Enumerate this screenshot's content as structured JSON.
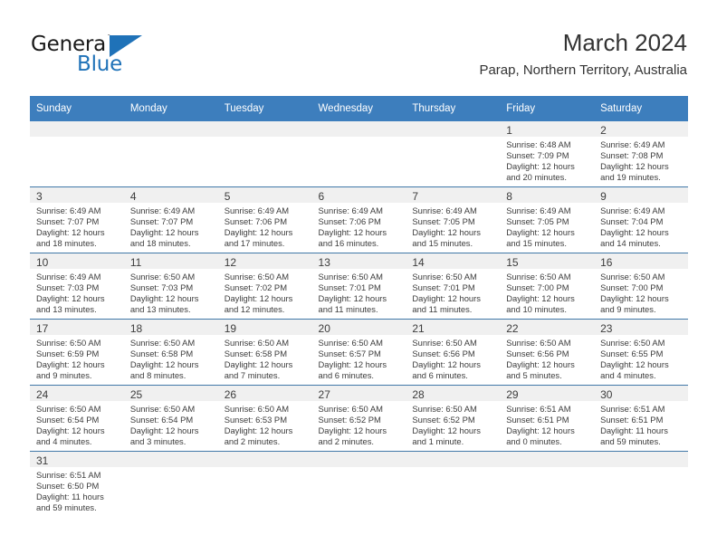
{
  "brand": {
    "name_top": "General",
    "name_bottom": "Blue",
    "accent_color": "#1f72b8"
  },
  "header": {
    "month_title": "March 2024",
    "location": "Parap, Northern Territory, Australia"
  },
  "theme": {
    "header_row_bg": "#3d7ebd",
    "cell_shade_bg": "#f0f0f0",
    "grid_line": "#4178a8",
    "text": "#3c3c3c"
  },
  "calendar": {
    "weekday_headers": [
      "Sunday",
      "Monday",
      "Tuesday",
      "Wednesday",
      "Thursday",
      "Friday",
      "Saturday"
    ],
    "weeks": [
      [
        {
          "empty": true
        },
        {
          "empty": true
        },
        {
          "empty": true
        },
        {
          "empty": true
        },
        {
          "empty": true
        },
        {
          "day": "1",
          "sunrise": "Sunrise: 6:48 AM",
          "sunset": "Sunset: 7:09 PM",
          "daylight1": "Daylight: 12 hours",
          "daylight2": "and 20 minutes."
        },
        {
          "day": "2",
          "sunrise": "Sunrise: 6:49 AM",
          "sunset": "Sunset: 7:08 PM",
          "daylight1": "Daylight: 12 hours",
          "daylight2": "and 19 minutes."
        }
      ],
      [
        {
          "day": "3",
          "sunrise": "Sunrise: 6:49 AM",
          "sunset": "Sunset: 7:07 PM",
          "daylight1": "Daylight: 12 hours",
          "daylight2": "and 18 minutes."
        },
        {
          "day": "4",
          "sunrise": "Sunrise: 6:49 AM",
          "sunset": "Sunset: 7:07 PM",
          "daylight1": "Daylight: 12 hours",
          "daylight2": "and 18 minutes."
        },
        {
          "day": "5",
          "sunrise": "Sunrise: 6:49 AM",
          "sunset": "Sunset: 7:06 PM",
          "daylight1": "Daylight: 12 hours",
          "daylight2": "and 17 minutes."
        },
        {
          "day": "6",
          "sunrise": "Sunrise: 6:49 AM",
          "sunset": "Sunset: 7:06 PM",
          "daylight1": "Daylight: 12 hours",
          "daylight2": "and 16 minutes."
        },
        {
          "day": "7",
          "sunrise": "Sunrise: 6:49 AM",
          "sunset": "Sunset: 7:05 PM",
          "daylight1": "Daylight: 12 hours",
          "daylight2": "and 15 minutes."
        },
        {
          "day": "8",
          "sunrise": "Sunrise: 6:49 AM",
          "sunset": "Sunset: 7:05 PM",
          "daylight1": "Daylight: 12 hours",
          "daylight2": "and 15 minutes."
        },
        {
          "day": "9",
          "sunrise": "Sunrise: 6:49 AM",
          "sunset": "Sunset: 7:04 PM",
          "daylight1": "Daylight: 12 hours",
          "daylight2": "and 14 minutes."
        }
      ],
      [
        {
          "day": "10",
          "sunrise": "Sunrise: 6:49 AM",
          "sunset": "Sunset: 7:03 PM",
          "daylight1": "Daylight: 12 hours",
          "daylight2": "and 13 minutes."
        },
        {
          "day": "11",
          "sunrise": "Sunrise: 6:50 AM",
          "sunset": "Sunset: 7:03 PM",
          "daylight1": "Daylight: 12 hours",
          "daylight2": "and 13 minutes."
        },
        {
          "day": "12",
          "sunrise": "Sunrise: 6:50 AM",
          "sunset": "Sunset: 7:02 PM",
          "daylight1": "Daylight: 12 hours",
          "daylight2": "and 12 minutes."
        },
        {
          "day": "13",
          "sunrise": "Sunrise: 6:50 AM",
          "sunset": "Sunset: 7:01 PM",
          "daylight1": "Daylight: 12 hours",
          "daylight2": "and 11 minutes."
        },
        {
          "day": "14",
          "sunrise": "Sunrise: 6:50 AM",
          "sunset": "Sunset: 7:01 PM",
          "daylight1": "Daylight: 12 hours",
          "daylight2": "and 11 minutes."
        },
        {
          "day": "15",
          "sunrise": "Sunrise: 6:50 AM",
          "sunset": "Sunset: 7:00 PM",
          "daylight1": "Daylight: 12 hours",
          "daylight2": "and 10 minutes."
        },
        {
          "day": "16",
          "sunrise": "Sunrise: 6:50 AM",
          "sunset": "Sunset: 7:00 PM",
          "daylight1": "Daylight: 12 hours",
          "daylight2": "and 9 minutes."
        }
      ],
      [
        {
          "day": "17",
          "sunrise": "Sunrise: 6:50 AM",
          "sunset": "Sunset: 6:59 PM",
          "daylight1": "Daylight: 12 hours",
          "daylight2": "and 9 minutes."
        },
        {
          "day": "18",
          "sunrise": "Sunrise: 6:50 AM",
          "sunset": "Sunset: 6:58 PM",
          "daylight1": "Daylight: 12 hours",
          "daylight2": "and 8 minutes."
        },
        {
          "day": "19",
          "sunrise": "Sunrise: 6:50 AM",
          "sunset": "Sunset: 6:58 PM",
          "daylight1": "Daylight: 12 hours",
          "daylight2": "and 7 minutes."
        },
        {
          "day": "20",
          "sunrise": "Sunrise: 6:50 AM",
          "sunset": "Sunset: 6:57 PM",
          "daylight1": "Daylight: 12 hours",
          "daylight2": "and 6 minutes."
        },
        {
          "day": "21",
          "sunrise": "Sunrise: 6:50 AM",
          "sunset": "Sunset: 6:56 PM",
          "daylight1": "Daylight: 12 hours",
          "daylight2": "and 6 minutes."
        },
        {
          "day": "22",
          "sunrise": "Sunrise: 6:50 AM",
          "sunset": "Sunset: 6:56 PM",
          "daylight1": "Daylight: 12 hours",
          "daylight2": "and 5 minutes."
        },
        {
          "day": "23",
          "sunrise": "Sunrise: 6:50 AM",
          "sunset": "Sunset: 6:55 PM",
          "daylight1": "Daylight: 12 hours",
          "daylight2": "and 4 minutes."
        }
      ],
      [
        {
          "day": "24",
          "sunrise": "Sunrise: 6:50 AM",
          "sunset": "Sunset: 6:54 PM",
          "daylight1": "Daylight: 12 hours",
          "daylight2": "and 4 minutes."
        },
        {
          "day": "25",
          "sunrise": "Sunrise: 6:50 AM",
          "sunset": "Sunset: 6:54 PM",
          "daylight1": "Daylight: 12 hours",
          "daylight2": "and 3 minutes."
        },
        {
          "day": "26",
          "sunrise": "Sunrise: 6:50 AM",
          "sunset": "Sunset: 6:53 PM",
          "daylight1": "Daylight: 12 hours",
          "daylight2": "and 2 minutes."
        },
        {
          "day": "27",
          "sunrise": "Sunrise: 6:50 AM",
          "sunset": "Sunset: 6:52 PM",
          "daylight1": "Daylight: 12 hours",
          "daylight2": "and 2 minutes."
        },
        {
          "day": "28",
          "sunrise": "Sunrise: 6:50 AM",
          "sunset": "Sunset: 6:52 PM",
          "daylight1": "Daylight: 12 hours",
          "daylight2": "and 1 minute."
        },
        {
          "day": "29",
          "sunrise": "Sunrise: 6:51 AM",
          "sunset": "Sunset: 6:51 PM",
          "daylight1": "Daylight: 12 hours",
          "daylight2": "and 0 minutes."
        },
        {
          "day": "30",
          "sunrise": "Sunrise: 6:51 AM",
          "sunset": "Sunset: 6:51 PM",
          "daylight1": "Daylight: 11 hours",
          "daylight2": "and 59 minutes."
        }
      ],
      [
        {
          "day": "31",
          "sunrise": "Sunrise: 6:51 AM",
          "sunset": "Sunset: 6:50 PM",
          "daylight1": "Daylight: 11 hours",
          "daylight2": "and 59 minutes."
        },
        {
          "empty": true
        },
        {
          "empty": true
        },
        {
          "empty": true
        },
        {
          "empty": true
        },
        {
          "empty": true
        },
        {
          "empty": true
        }
      ]
    ]
  }
}
